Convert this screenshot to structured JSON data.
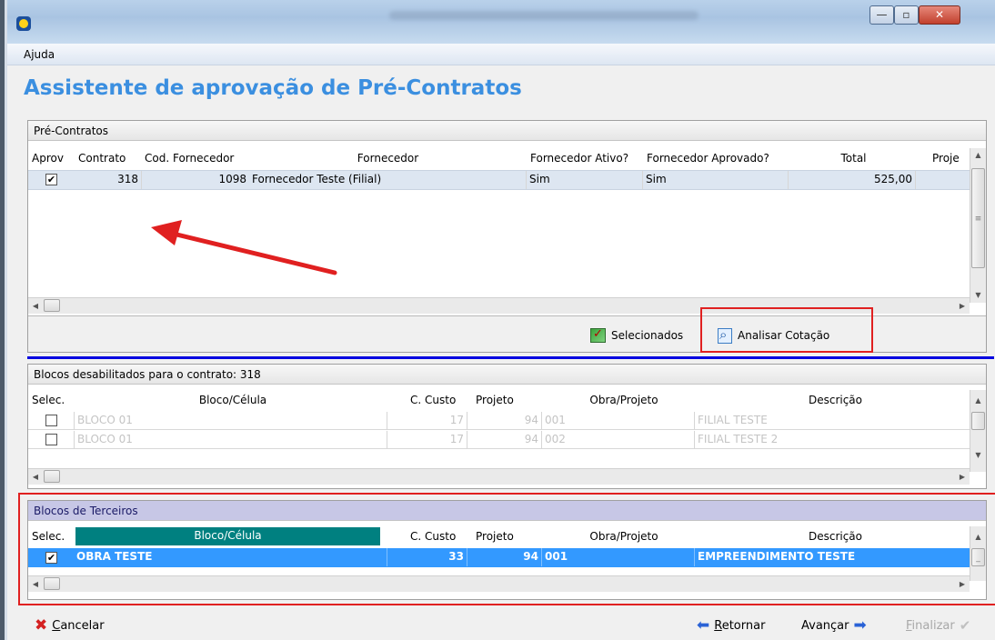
{
  "menu": {
    "help": "Ajuda"
  },
  "page": {
    "title": "Assistente de aprovação de Pré-Contratos"
  },
  "precontratos": {
    "title": "Pré-Contratos",
    "columns": [
      "Aprov",
      "Contrato",
      "Cod. Fornecedor",
      "Fornecedor",
      "Fornecedor Ativo?",
      "Fornecedor Aprovado?",
      "Total",
      "Proje"
    ],
    "rows": [
      {
        "aprov": "✔",
        "contrato": "318",
        "cod_fornecedor": "1098",
        "fornecedor": "Fornecedor Teste (Filial)",
        "ativo": "Sim",
        "aprovado": "Sim",
        "total": "525,00",
        "projeto": ""
      }
    ],
    "buttons": {
      "selecionados": "Selecionados",
      "analisar": "Analisar Cotação"
    }
  },
  "bloqueados": {
    "title": "Blocos desabilitados para o contrato: 318",
    "columns": [
      "Selec.",
      "Bloco/Célula",
      "C. Custo",
      "Projeto",
      "Obra/Projeto",
      "Descrição"
    ],
    "rows": [
      {
        "selec": "",
        "bloco": "BLOCO 01",
        "custo": "17",
        "projeto": "94",
        "obra": "001",
        "descricao": "FILIAL TESTE"
      },
      {
        "selec": "",
        "bloco": "BLOCO 01",
        "custo": "17",
        "projeto": "94",
        "obra": "002",
        "descricao": "FILIAL TESTE 2"
      }
    ]
  },
  "terceiros": {
    "title": "Blocos de Terceiros",
    "columns": [
      "Selec.",
      "Bloco/Célula",
      "C. Custo",
      "Projeto",
      "Obra/Projeto",
      "Descrição"
    ],
    "rows": [
      {
        "selec": "✔",
        "bloco": "OBRA TESTE",
        "custo": "33",
        "projeto": "94",
        "obra": "001",
        "descricao": "EMPREENDIMENTO TESTE"
      }
    ]
  },
  "footer": {
    "cancel_first": "C",
    "cancel_rest": "ancelar",
    "back_first": "R",
    "back_rest": "etornar",
    "next": "Avançar",
    "finish_first": "F",
    "finish_rest": "inalizar"
  },
  "colors": {
    "accent": "#3b8fe0",
    "selected_row": "#3399ff",
    "header_highlight": "#008080",
    "annotation": "#e02020"
  }
}
